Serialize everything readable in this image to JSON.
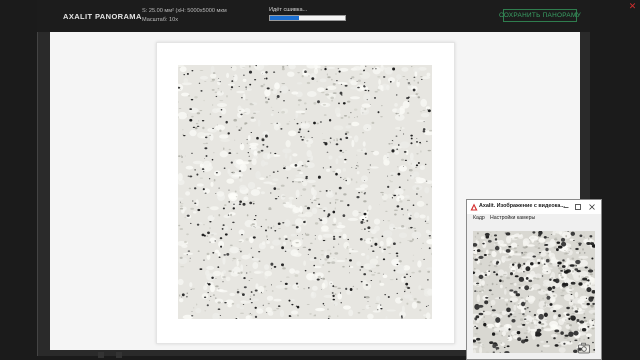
{
  "app": {
    "brand": "AXALIT PANORAMA",
    "info_line1": "S: 25.00 мм² (xН: 5000x5000 мкм",
    "info_line2": "Масштаб: 10x",
    "status_text": "Идёт сшивка...",
    "progress_fraction": 0.38,
    "save_label": "СОХРАНИТЬ ПАНОРАМУ",
    "accent_color": "#3aa366",
    "progress_color": "#1c6fd0"
  },
  "camera_window": {
    "title": "Axalit. Изображение с видеока...",
    "menu": [
      "Кадр",
      "Настройки камеры"
    ],
    "controls": [
      "minimize-icon",
      "maximize-icon",
      "close-icon"
    ],
    "snapshot_icon": "camera-icon"
  },
  "corner_icon": "close-icon"
}
